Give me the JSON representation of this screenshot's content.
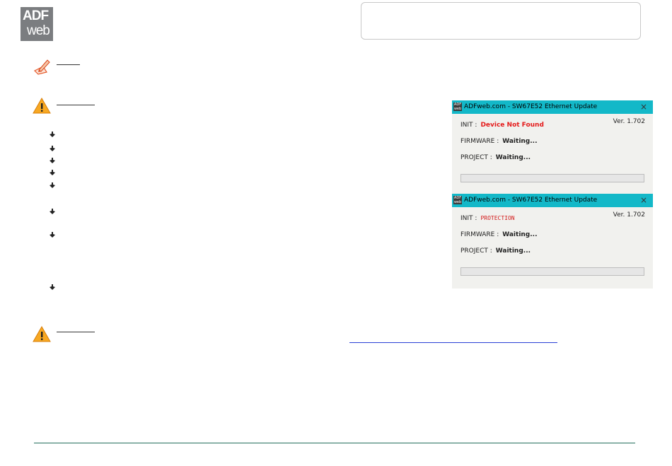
{
  "logo": {
    "line1": "ADF",
    "line2": "web"
  },
  "windows": [
    {
      "title": "ADFweb.com - SW67E52 Ethernet Update",
      "close": "×",
      "version": "Ver. 1.702",
      "init_label": "INIT :",
      "init_value": "Device Not Found",
      "firmware_label": "FIRMWARE :",
      "firmware_value": "Waiting...",
      "project_label": "PROJECT :",
      "project_value": "Waiting...",
      "progress": 0
    },
    {
      "title": "ADFweb.com - SW67E52 Ethernet Update",
      "close": "×",
      "version": "Ver. 1.702",
      "init_label": "INIT :",
      "init_value": "PROTECTION",
      "firmware_label": "FIRMWARE :",
      "firmware_value": "Waiting...",
      "project_label": "PROJECT :",
      "project_value": "Waiting...",
      "progress": 0
    }
  ],
  "icons": {
    "note": "note-pencil-icon",
    "warning": "warning-triangle-icon",
    "bullet": "hand-pointer-icon"
  },
  "colors": {
    "titlebar": "#13b8c8",
    "error_text": "#e41a1a",
    "link": "#2a3fd6",
    "footer_rule": "#1f6b5a",
    "warning": "#f39c12"
  }
}
